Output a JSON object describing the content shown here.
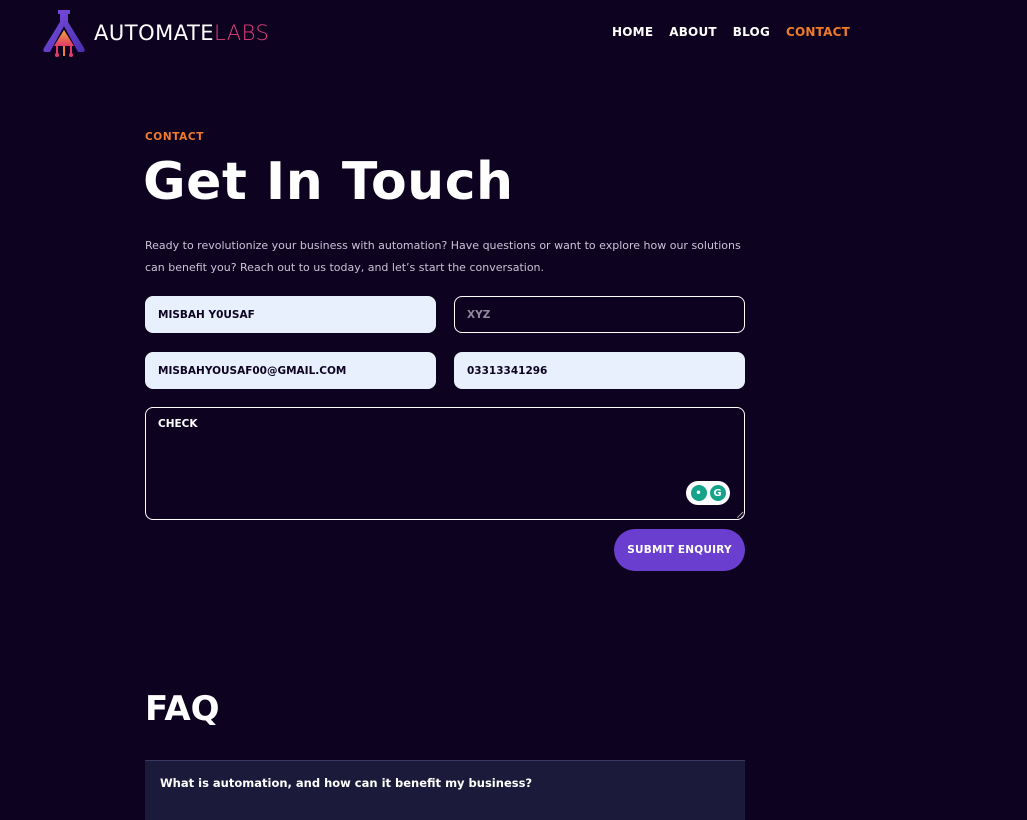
{
  "brand": {
    "name_primary": "AUTOMATE",
    "name_secondary": "LABS"
  },
  "nav": {
    "items": [
      {
        "label": "HOME",
        "active": false
      },
      {
        "label": "ABOUT",
        "active": false
      },
      {
        "label": "BLOG",
        "active": false
      },
      {
        "label": "CONTACT",
        "active": true
      }
    ]
  },
  "contact": {
    "eyebrow": "CONTACT",
    "title": "Get In Touch",
    "lead": "Ready to revolutionize your business with automation? Have questions or want to explore how our solutions can benefit you? Reach out to us today, and let’s start the conversation.",
    "fields": {
      "name_value": "MISBAH Y0USAF",
      "second_placeholder": "XYZ",
      "email_value": "MISBAHYOUSAF00@GMAIL.COM",
      "phone_value": "03313341296",
      "message_value": "CHECK"
    },
    "submit_label": "SUBMIT ENQUIRY"
  },
  "faq": {
    "title": "FAQ",
    "items": [
      {
        "question": "What is automation, and how can it benefit my business?"
      }
    ]
  },
  "colors": {
    "background": "#0d0320",
    "accent_orange": "#f07b2a",
    "button_purple": "#6a3fd0",
    "input_fill": "#e8effd",
    "faq_panel": "#1c1a3a"
  },
  "icons": {
    "logo": "flask-logo-icon",
    "grammarly": "grammarly-icon"
  }
}
